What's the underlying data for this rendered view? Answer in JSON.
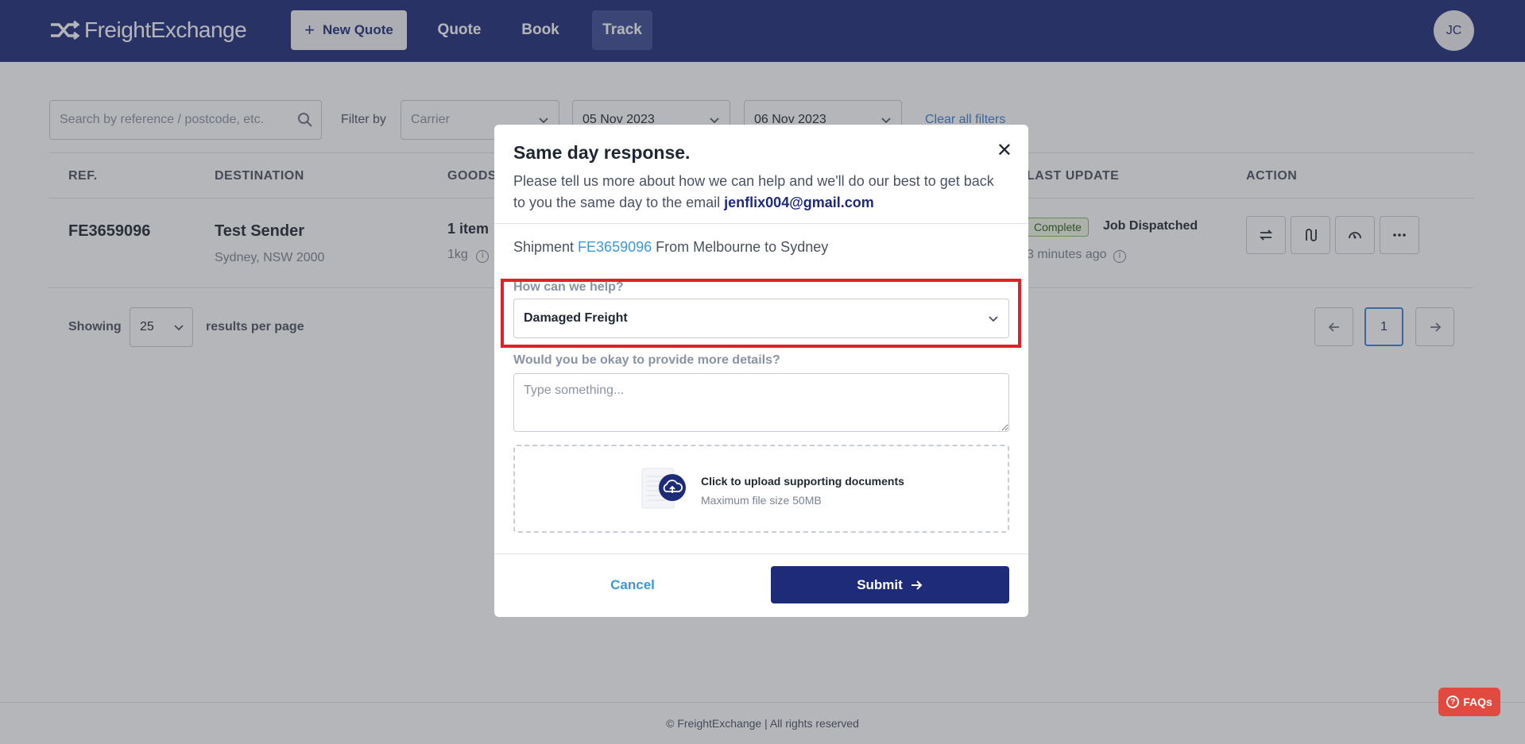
{
  "header": {
    "brand": "FreightExchange",
    "new_quote_label": "New Quote",
    "nav": [
      "Quote",
      "Book",
      "Track"
    ],
    "active_nav": "Track",
    "avatar_initials": "JC"
  },
  "filters": {
    "search_placeholder": "Search by reference / postcode, etc.",
    "filter_by_label": "Filter by",
    "carrier_placeholder": "Carrier",
    "date_from": "05 Nov 2023",
    "date_to": "06 Nov 2023",
    "clear_label": "Clear all filters"
  },
  "table": {
    "columns": [
      "REF.",
      "DESTINATION",
      "GOODS",
      "LAST UPDATE",
      "ACTION"
    ],
    "rows": [
      {
        "ref": "FE3659096",
        "dest_name": "Test Sender",
        "dest_sub": "Sydney, NSW 2000",
        "goods_count": "1 item",
        "goods_weight": "1kg",
        "status_badge": "Complete",
        "status_text": "Job Dispatched",
        "time_ago": "3 minutes ago"
      }
    ]
  },
  "pagination": {
    "showing_label": "Showing",
    "per_page_value": "25",
    "per_page_label": "results per page",
    "current_page": "1"
  },
  "footer": {
    "copyright": "© FreightExchange | All rights reserved",
    "faqs_label": "FAQs"
  },
  "modal": {
    "title": "Same day response.",
    "description": "Please tell us more about how we can help and we'll do our best to get back to you the same day to the email ",
    "email": "jenflix004@gmail.com",
    "shipment_prefix": "Shipment ",
    "shipment_ref": "FE3659096",
    "shipment_suffix": " From Melbourne to Sydney",
    "q1_label": "How can we help?",
    "q1_value": "Damaged Freight",
    "q2_label": "Would you be okay to provide more details?",
    "q2_placeholder": "Type something...",
    "upload_title": "Click to upload supporting documents",
    "upload_sub": "Maximum file size 50MB",
    "cancel_label": "Cancel",
    "submit_label": "Submit"
  },
  "colors": {
    "brand_navy": "#1d2b78",
    "link_blue": "#3a9ad9",
    "highlight_red": "#e0212b",
    "complete_green": "#7bbf5d",
    "faqs_red": "#e2493f"
  },
  "icons": [
    "logo-icon",
    "plus-icon",
    "search-icon",
    "chevron-down-icon",
    "info-icon",
    "swap-icon",
    "route-icon",
    "support-icon",
    "more-icon",
    "arrow-left-icon",
    "arrow-right-icon",
    "close-icon",
    "upload-cloud-icon",
    "question-icon"
  ]
}
